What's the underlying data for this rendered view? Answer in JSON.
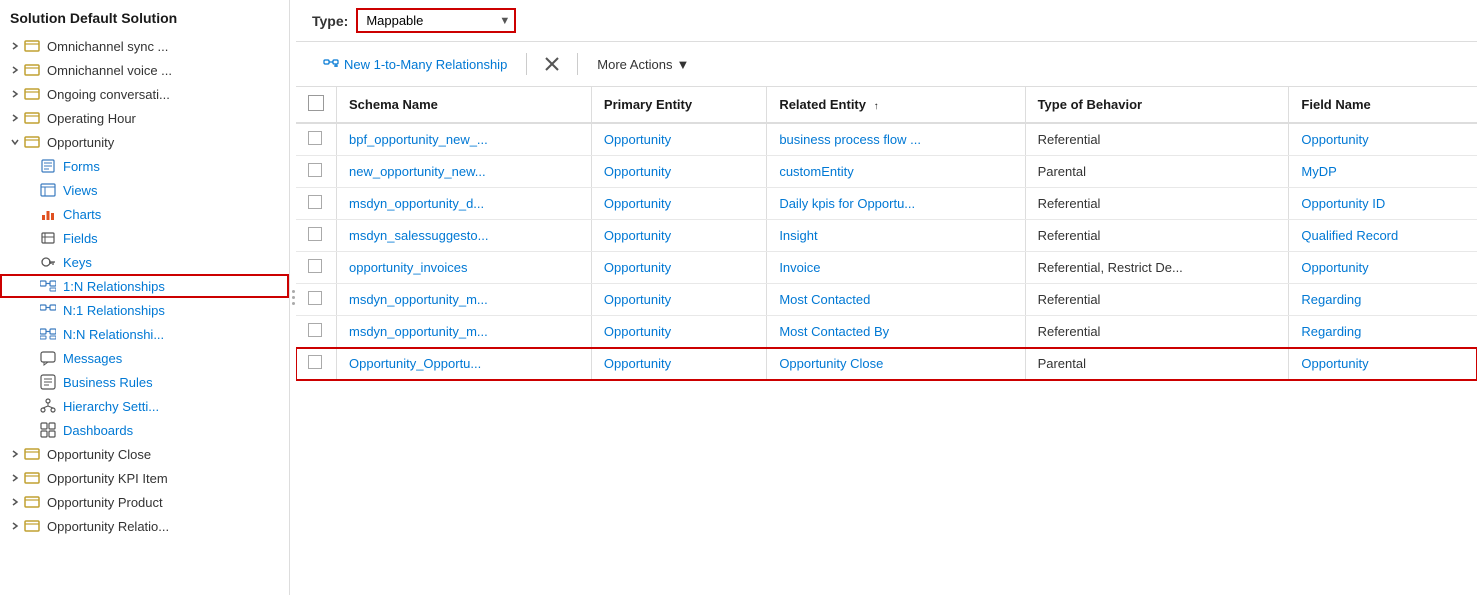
{
  "sidebar": {
    "title": "Solution Default Solution",
    "items": [
      {
        "id": "omnichannel-sync",
        "label": "Omnichannel sync ...",
        "indent": 1,
        "type": "entity",
        "hasChevron": true
      },
      {
        "id": "omnichannel-voice",
        "label": "Omnichannel voice ...",
        "indent": 1,
        "type": "entity",
        "hasChevron": true
      },
      {
        "id": "ongoing-conversation",
        "label": "Ongoing conversati...",
        "indent": 1,
        "type": "entity",
        "hasChevron": true
      },
      {
        "id": "operating-hour",
        "label": "Operating Hour",
        "indent": 1,
        "type": "entity",
        "hasChevron": true
      },
      {
        "id": "opportunity",
        "label": "Opportunity",
        "indent": 1,
        "type": "entity-open",
        "hasChevron": true,
        "expanded": true
      },
      {
        "id": "forms",
        "label": "Forms",
        "indent": 2,
        "type": "forms"
      },
      {
        "id": "views",
        "label": "Views",
        "indent": 2,
        "type": "views"
      },
      {
        "id": "charts",
        "label": "Charts",
        "indent": 2,
        "type": "charts"
      },
      {
        "id": "fields",
        "label": "Fields",
        "indent": 2,
        "type": "fields"
      },
      {
        "id": "keys",
        "label": "Keys",
        "indent": 2,
        "type": "keys"
      },
      {
        "id": "1n-relationships",
        "label": "1:N Relationships",
        "indent": 2,
        "type": "1n",
        "highlighted": true
      },
      {
        "id": "n1-relationships",
        "label": "N:1 Relationships",
        "indent": 2,
        "type": "n1"
      },
      {
        "id": "nn-relationships",
        "label": "N:N Relationshi...",
        "indent": 2,
        "type": "nn"
      },
      {
        "id": "messages",
        "label": "Messages",
        "indent": 2,
        "type": "messages"
      },
      {
        "id": "business-rules",
        "label": "Business Rules",
        "indent": 2,
        "type": "business-rules"
      },
      {
        "id": "hierarchy-settings",
        "label": "Hierarchy Setti...",
        "indent": 2,
        "type": "hierarchy"
      },
      {
        "id": "dashboards",
        "label": "Dashboards",
        "indent": 2,
        "type": "dashboards"
      },
      {
        "id": "opportunity-close",
        "label": "Opportunity Close",
        "indent": 1,
        "type": "entity",
        "hasChevron": true
      },
      {
        "id": "opportunity-kpi",
        "label": "Opportunity KPI Item",
        "indent": 1,
        "type": "entity",
        "hasChevron": true
      },
      {
        "id": "opportunity-product",
        "label": "Opportunity Product",
        "indent": 1,
        "type": "entity",
        "hasChevron": true
      },
      {
        "id": "opportunity-relatio",
        "label": "Opportunity Relatio...",
        "indent": 1,
        "type": "entity",
        "hasChevron": true
      }
    ]
  },
  "toolbar": {
    "new_relationship_label": "New 1-to-Many Relationship",
    "delete_label": "",
    "more_actions_label": "More Actions"
  },
  "type_bar": {
    "label": "Type:",
    "value": "Mappable"
  },
  "table": {
    "columns": [
      {
        "id": "schema-name",
        "label": "Schema Name"
      },
      {
        "id": "primary-entity",
        "label": "Primary Entity"
      },
      {
        "id": "related-entity",
        "label": "Related Entity ↑"
      },
      {
        "id": "type-of-behavior",
        "label": "Type of Behavior"
      },
      {
        "id": "field-name",
        "label": "Field Name"
      }
    ],
    "rows": [
      {
        "schema": "bpf_opportunity_new_...",
        "primary": "Opportunity",
        "related": "business process flow ...",
        "behavior": "Referential",
        "field": "Opportunity",
        "highlighted": false
      },
      {
        "schema": "new_opportunity_new...",
        "primary": "Opportunity",
        "related": "customEntity",
        "behavior": "Parental",
        "field": "MyDP",
        "highlighted": false
      },
      {
        "schema": "msdyn_opportunity_d...",
        "primary": "Opportunity",
        "related": "Daily kpis for Opportu...",
        "behavior": "Referential",
        "field": "Opportunity ID",
        "highlighted": false
      },
      {
        "schema": "msdyn_salessuggesto...",
        "primary": "Opportunity",
        "related": "Insight",
        "behavior": "Referential",
        "field": "Qualified Record",
        "highlighted": false
      },
      {
        "schema": "opportunity_invoices",
        "primary": "Opportunity",
        "related": "Invoice",
        "behavior": "Referential, Restrict De...",
        "field": "Opportunity",
        "highlighted": false
      },
      {
        "schema": "msdyn_opportunity_m...",
        "primary": "Opportunity",
        "related": "Most Contacted",
        "behavior": "Referential",
        "field": "Regarding",
        "highlighted": false
      },
      {
        "schema": "msdyn_opportunity_m...",
        "primary": "Opportunity",
        "related": "Most Contacted By",
        "behavior": "Referential",
        "field": "Regarding",
        "highlighted": false
      },
      {
        "schema": "Opportunity_Opportu...",
        "primary": "Opportunity",
        "related": "Opportunity Close",
        "behavior": "Parental",
        "field": "Opportunity",
        "highlighted": true
      }
    ]
  }
}
